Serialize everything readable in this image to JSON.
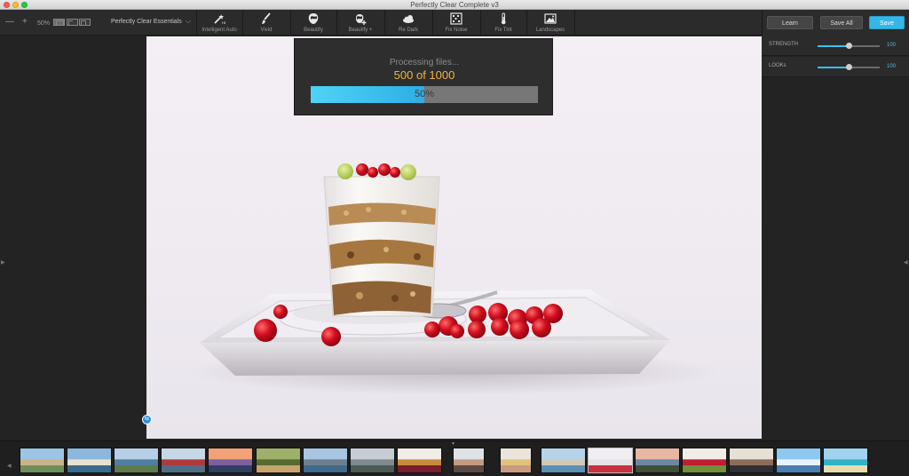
{
  "window": {
    "title": "Perfectly Clear Complete v3"
  },
  "toolbar": {
    "zoom_out": "—",
    "zoom_in": "+",
    "zoom_level": "50%",
    "preset": "Perfectly Clear Essentials",
    "tools": [
      {
        "label": "Intelligent Auto",
        "icon": "wand-icon"
      },
      {
        "label": "Vivid",
        "icon": "brush-icon"
      },
      {
        "label": "Beautify",
        "icon": "face-icon"
      },
      {
        "label": "Beautify +",
        "icon": "face-plus-icon"
      },
      {
        "label": "Re Dark",
        "icon": "cloud-icon"
      },
      {
        "label": "Fix Noise",
        "icon": "noise-icon"
      },
      {
        "label": "Fix Tint",
        "icon": "thermometer-icon"
      },
      {
        "label": "Landscapes",
        "icon": "landscape-icon"
      }
    ]
  },
  "header_buttons": {
    "learn": "Learn",
    "save_all": "Save All",
    "save": "Save"
  },
  "adjustments": {
    "strength": {
      "label": "STRENGTH",
      "value": "100",
      "level": 0.5
    },
    "looks": {
      "label": "LOOKs",
      "value": "100",
      "level": 0.5
    }
  },
  "processing": {
    "title": "Processing files...",
    "count": "500 of 1000",
    "percent_label": "50%",
    "progress": 0.5
  },
  "colors": {
    "accent": "#35b6e8",
    "count_text": "#f0b43c",
    "background": "#232323"
  },
  "filmstrip": {
    "thumbnails": [
      "coast",
      "beach-boats",
      "lake-cabins",
      "harbor",
      "sunset-dock",
      "forest-path",
      "mountain-lake",
      "foggy-forest",
      "pancakes",
      "woman-portrait",
      "blonde-portrait",
      "dock-sea",
      "dessert-glass",
      "rocky-coast",
      "berries",
      "mountain-people",
      "ferris-wheel",
      "tropical-island"
    ],
    "selected_index": 12
  }
}
